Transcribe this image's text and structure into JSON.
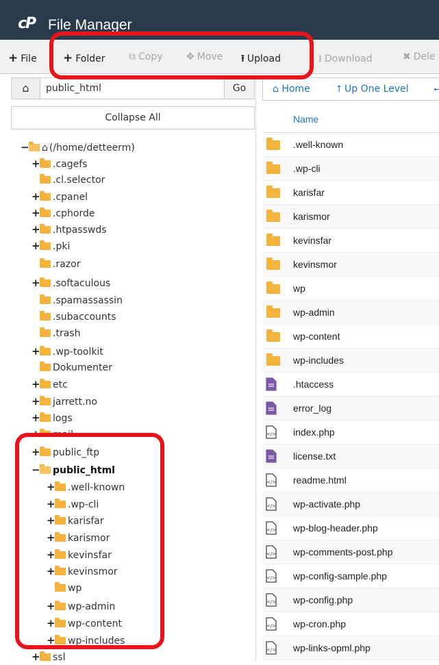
{
  "app": {
    "logo": "cP",
    "title": "File Manager"
  },
  "toolbar": {
    "file": "File",
    "folder": "Folder",
    "copy": "Copy",
    "move": "Move",
    "upload": "Upload",
    "download": "Download",
    "delete": "Dele"
  },
  "path": {
    "value": "public_html",
    "go": "Go"
  },
  "collapse_all": "Collapse All",
  "nav": {
    "home": "Home",
    "up": "Up One Level"
  },
  "tree": [
    {
      "toggle": "−",
      "label": "(/home/detteerm)",
      "bold": false
    },
    {
      "toggle": "+",
      "label": ".cagefs"
    },
    {
      "toggle": "",
      "label": ".cl.selector"
    },
    {
      "toggle": "+",
      "label": ".cpanel"
    },
    {
      "toggle": "+",
      "label": ".cphorde"
    },
    {
      "toggle": "+",
      "label": ".htpasswds"
    },
    {
      "toggle": "+",
      "label": ".pki"
    },
    {
      "toggle": "",
      "label": ".razor"
    },
    {
      "toggle": "+",
      "label": ".softaculous"
    },
    {
      "toggle": "",
      "label": ".spamassassin"
    },
    {
      "toggle": "",
      "label": ".subaccounts"
    },
    {
      "toggle": "",
      "label": ".trash"
    },
    {
      "toggle": "+",
      "label": ".wp-toolkit"
    },
    {
      "toggle": "",
      "label": "Dokumenter"
    },
    {
      "toggle": "+",
      "label": "etc"
    },
    {
      "toggle": "+",
      "label": "jarrett.no"
    },
    {
      "toggle": "+",
      "label": "logs"
    },
    {
      "toggle": "+",
      "label": "mail"
    },
    {
      "toggle": "+",
      "label": "public_ftp"
    },
    {
      "toggle": "−",
      "label": "public_html",
      "bold": true
    },
    {
      "toggle": "+",
      "label": ".well-known"
    },
    {
      "toggle": "+",
      "label": ".wp-cli"
    },
    {
      "toggle": "+",
      "label": "karisfar"
    },
    {
      "toggle": "+",
      "label": "karismor"
    },
    {
      "toggle": "+",
      "label": "kevinsfar"
    },
    {
      "toggle": "+",
      "label": "kevinsmor"
    },
    {
      "toggle": "",
      "label": "wp"
    },
    {
      "toggle": "+",
      "label": "wp-admin"
    },
    {
      "toggle": "+",
      "label": "wp-content"
    },
    {
      "toggle": "+",
      "label": "wp-includes"
    },
    {
      "toggle": "+",
      "label": "ssl"
    }
  ],
  "table": {
    "header_name": "Name",
    "rows": [
      {
        "name": ".well-known",
        "type": "folder"
      },
      {
        "name": ".wp-cli",
        "type": "folder"
      },
      {
        "name": "karisfar",
        "type": "folder"
      },
      {
        "name": "karismor",
        "type": "folder"
      },
      {
        "name": "kevinsfar",
        "type": "folder"
      },
      {
        "name": "kevinsmor",
        "type": "folder"
      },
      {
        "name": "wp",
        "type": "folder"
      },
      {
        "name": "wp-admin",
        "type": "folder"
      },
      {
        "name": "wp-content",
        "type": "folder"
      },
      {
        "name": "wp-includes",
        "type": "folder"
      },
      {
        "name": ".htaccess",
        "type": "text"
      },
      {
        "name": "error_log",
        "type": "text"
      },
      {
        "name": "index.php",
        "type": "code"
      },
      {
        "name": "license.txt",
        "type": "text"
      },
      {
        "name": "readme.html",
        "type": "code"
      },
      {
        "name": "wp-activate.php",
        "type": "code"
      },
      {
        "name": "wp-blog-header.php",
        "type": "code"
      },
      {
        "name": "wp-comments-post.php",
        "type": "code"
      },
      {
        "name": "wp-config-sample.php",
        "type": "code"
      },
      {
        "name": "wp-config.php",
        "type": "code"
      },
      {
        "name": "wp-cron.php",
        "type": "code"
      },
      {
        "name": "wp-links-opml.php",
        "type": "code"
      }
    ]
  },
  "colors": {
    "titlebar": "#293a4a",
    "highlight": "#e8131b",
    "link": "#1e72c3",
    "folder": "#f3b33d",
    "textfile": "#7b5aa6"
  }
}
